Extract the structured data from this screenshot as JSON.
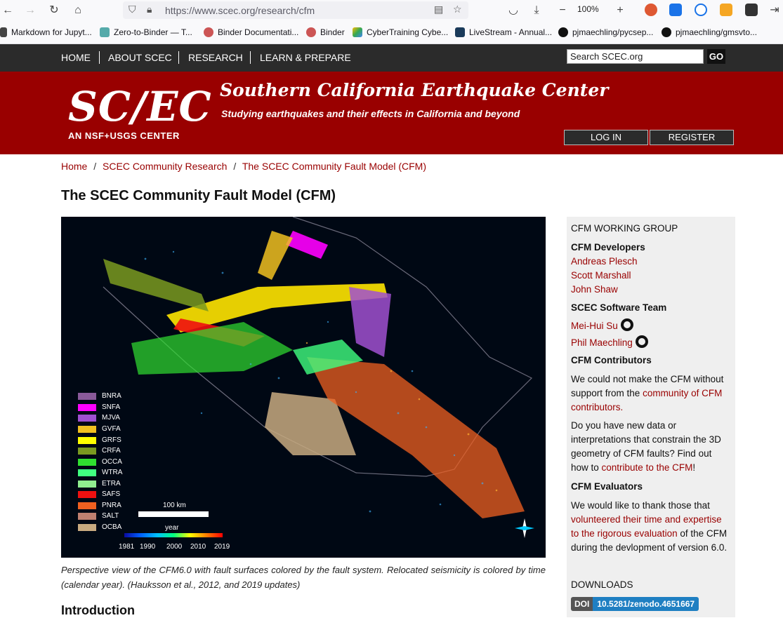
{
  "browser": {
    "url": "https://www.scec.org/research/cfm",
    "zoom": "100%",
    "bookmarks": [
      "Markdown for Jupyt...",
      "Zero-to-Binder — T...",
      "Binder Documentati...",
      "Binder",
      "CyberTraining Cybe...",
      "LiveStream - Annual...",
      "pjmaechling/pycsep...",
      "pjmaechling/gmsvto..."
    ]
  },
  "nav": {
    "items": [
      "HOME",
      "ABOUT SCEC",
      "RESEARCH",
      "LEARN & PREPARE"
    ],
    "search_value": "Search SCEC.org",
    "go_label": "GO"
  },
  "header": {
    "logo": "SC/EC",
    "logo_sub": "AN NSF+USGS CENTER",
    "title": "Southern California Earthquake Center",
    "tagline": "Studying earthquakes and their effects in California and beyond",
    "login": "LOG IN",
    "register": "REGISTER"
  },
  "breadcrumb": {
    "items": [
      "Home",
      "SCEC Community Research",
      "The SCEC Community Fault Model (CFM)"
    ],
    "sep": "/"
  },
  "page_title": "The SCEC Community Fault Model (CFM)",
  "figure": {
    "legend": [
      {
        "label": "BNRA",
        "color": "#8a5a9a"
      },
      {
        "label": "SNFA",
        "color": "#ff00ff"
      },
      {
        "label": "MJVA",
        "color": "#a050d0"
      },
      {
        "label": "GVFA",
        "color": "#f0c020"
      },
      {
        "label": "GRFS",
        "color": "#ffff00"
      },
      {
        "label": "CRFA",
        "color": "#7a9a20"
      },
      {
        "label": "OCCA",
        "color": "#30e030"
      },
      {
        "label": "WTRA",
        "color": "#40ff80"
      },
      {
        "label": "ETRA",
        "color": "#90ee90"
      },
      {
        "label": "SAFS",
        "color": "#ee1010"
      },
      {
        "label": "PNRA",
        "color": "#f06020"
      },
      {
        "label": "SALT",
        "color": "#c08070"
      },
      {
        "label": "OCBA",
        "color": "#c8aa80"
      }
    ],
    "scale": "100 km",
    "year_label": "year",
    "year_ticks": [
      "1981",
      "1990",
      "2000",
      "2010",
      "2019"
    ]
  },
  "caption": "Perspective view of the CFM6.0 with fault surfaces colored by the fault system. Relocated seismicity is colored by time (calendar year). (Hauksson et al., 2012, and 2019 updates)",
  "intro_heading": "Introduction",
  "sidebar": {
    "heading": "CFM WORKING GROUP",
    "developers_heading": "CFM Developers",
    "developers": [
      "Andreas Plesch",
      "Scott Marshall",
      "John Shaw"
    ],
    "software_heading": "SCEC Software Team",
    "software": [
      "Mei-Hui Su",
      "Phil Maechling"
    ],
    "contributors_heading": "CFM Contributors",
    "contrib_p1_a": "We could not make the CFM without support from the ",
    "contrib_p1_link": "community of CFM contributors.",
    "contrib_p2_a": "Do you have new data or interpretations that constrain the 3D geometry of CFM faults? Find out how to ",
    "contrib_p2_link": "contribute to the CFM",
    "contrib_p2_b": "!",
    "evaluators_heading": "CFM Evaluators",
    "eval_a": "We would like to thank those that ",
    "eval_link": "volunteered their time and expertise to the rigorous evaluation",
    "eval_b": " of the CFM during the devlopment of version 6.0.",
    "downloads_heading": "DOWNLOADS",
    "doi_label": "DOI",
    "doi_value": "10.5281/zenodo.4651667"
  }
}
